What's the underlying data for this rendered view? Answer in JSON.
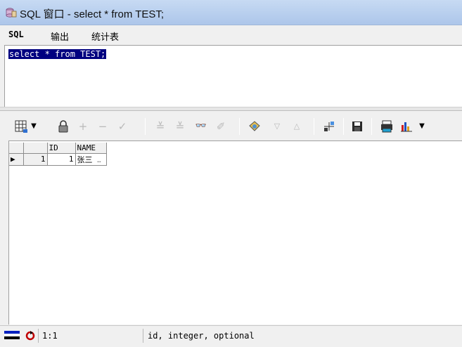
{
  "window": {
    "title": "SQL 窗口 - select * from TEST;"
  },
  "tabs": [
    {
      "label": "SQL"
    },
    {
      "label": "输出"
    },
    {
      "label": "统计表"
    }
  ],
  "editor": {
    "sql": "select * from TEST;"
  },
  "toolbar": {
    "icons": [
      "grid-view-icon",
      "dropdown-arrow-icon",
      "lock-icon",
      "add-record-icon",
      "delete-record-icon",
      "post-record-icon",
      "fetch-next-icon",
      "fetch-last-icon",
      "find-icon",
      "clear-icon",
      "query-by-example-icon",
      "next-record-icon",
      "prev-record-icon",
      "export-icon",
      "save-icon",
      "print-icon",
      "chart-icon",
      "chart-dropdown-icon"
    ]
  },
  "grid": {
    "columns": [
      "ID",
      "NAME"
    ],
    "rows": [
      {
        "row_num": "1",
        "id": "1",
        "name": "张三",
        "edit": "…"
      }
    ]
  },
  "statusbar": {
    "position": "1:1",
    "column_info": "id, integer, optional"
  }
}
